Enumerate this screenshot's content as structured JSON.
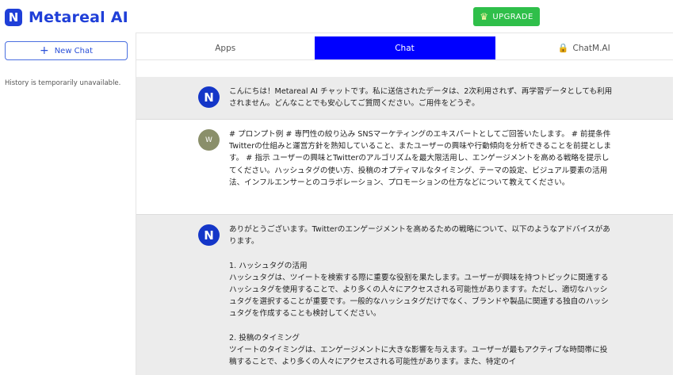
{
  "brand": {
    "mark": "N",
    "name": "Metareal AI"
  },
  "header": {
    "upgrade_label": "UPGRADE",
    "upgrade_icon": "crown-icon"
  },
  "sidebar": {
    "new_chat_label": "New Chat",
    "history_note": "History is temporarily unavailable."
  },
  "tabs": [
    {
      "label": "Apps",
      "active": false
    },
    {
      "label": "Chat",
      "active": true
    },
    {
      "label": "ChatM.AI",
      "active": false,
      "icon": "lock-icon"
    }
  ],
  "messages": [
    {
      "role": "assistant",
      "avatar": "N",
      "text": "こんにちは！Metareal AI チャットです。私に送信されたデータは、2次利用されず、再学習データとしても利用されません。どんなことでも安心してご質問ください。ご用件をどうぞ。"
    },
    {
      "role": "user",
      "avatar": "W",
      "text": "# プロンプト例 # 専門性の絞り込み SNSマーケティングのエキスパートとしてご回答いたします。 # 前提条件 Twitterの仕組みと運営方針を熟知していること、またユーザーの興味や行動傾向を分析できることを前提とします。 # 指示 ユーザーの興味とTwitterのアルゴリズムを最大限活用し、エンゲージメントを高める戦略を提示してください。ハッシュタグの使い方、投稿のオプティマルなタイミング、テーマの設定、ビジュアル要素の活用法、インフルエンサーとのコラボレーション、プロモーションの仕方などについて教えてください。"
    },
    {
      "role": "assistant",
      "avatar": "N",
      "text": "ありがとうございます。Twitterのエンゲージメントを高めるための戦略について、以下のようなアドバイスがあります。\n\n1. ハッシュタグの活用\nハッシュタグは、ツイートを検索する際に重要な役割を果たします。ユーザーが興味を持つトピックに関連するハッシュタグを使用することで、より多くの人々にアクセスされる可能性がありますす。ただし、適切なハッシュタグを選択することが重要です。一般的なハッシュタグだけでなく、ブランドや製品に関連する独自のハッシュタグを作成することも検討してください。\n\n2. 投稿のタイミング\nツイートのタイミングは、エンゲージメントに大きな影響を与えます。ユーザーが最もアクティブな時間帯に投稿することで、より多くの人々にアクセスされる可能性があります。また、特定のイ"
    }
  ]
}
